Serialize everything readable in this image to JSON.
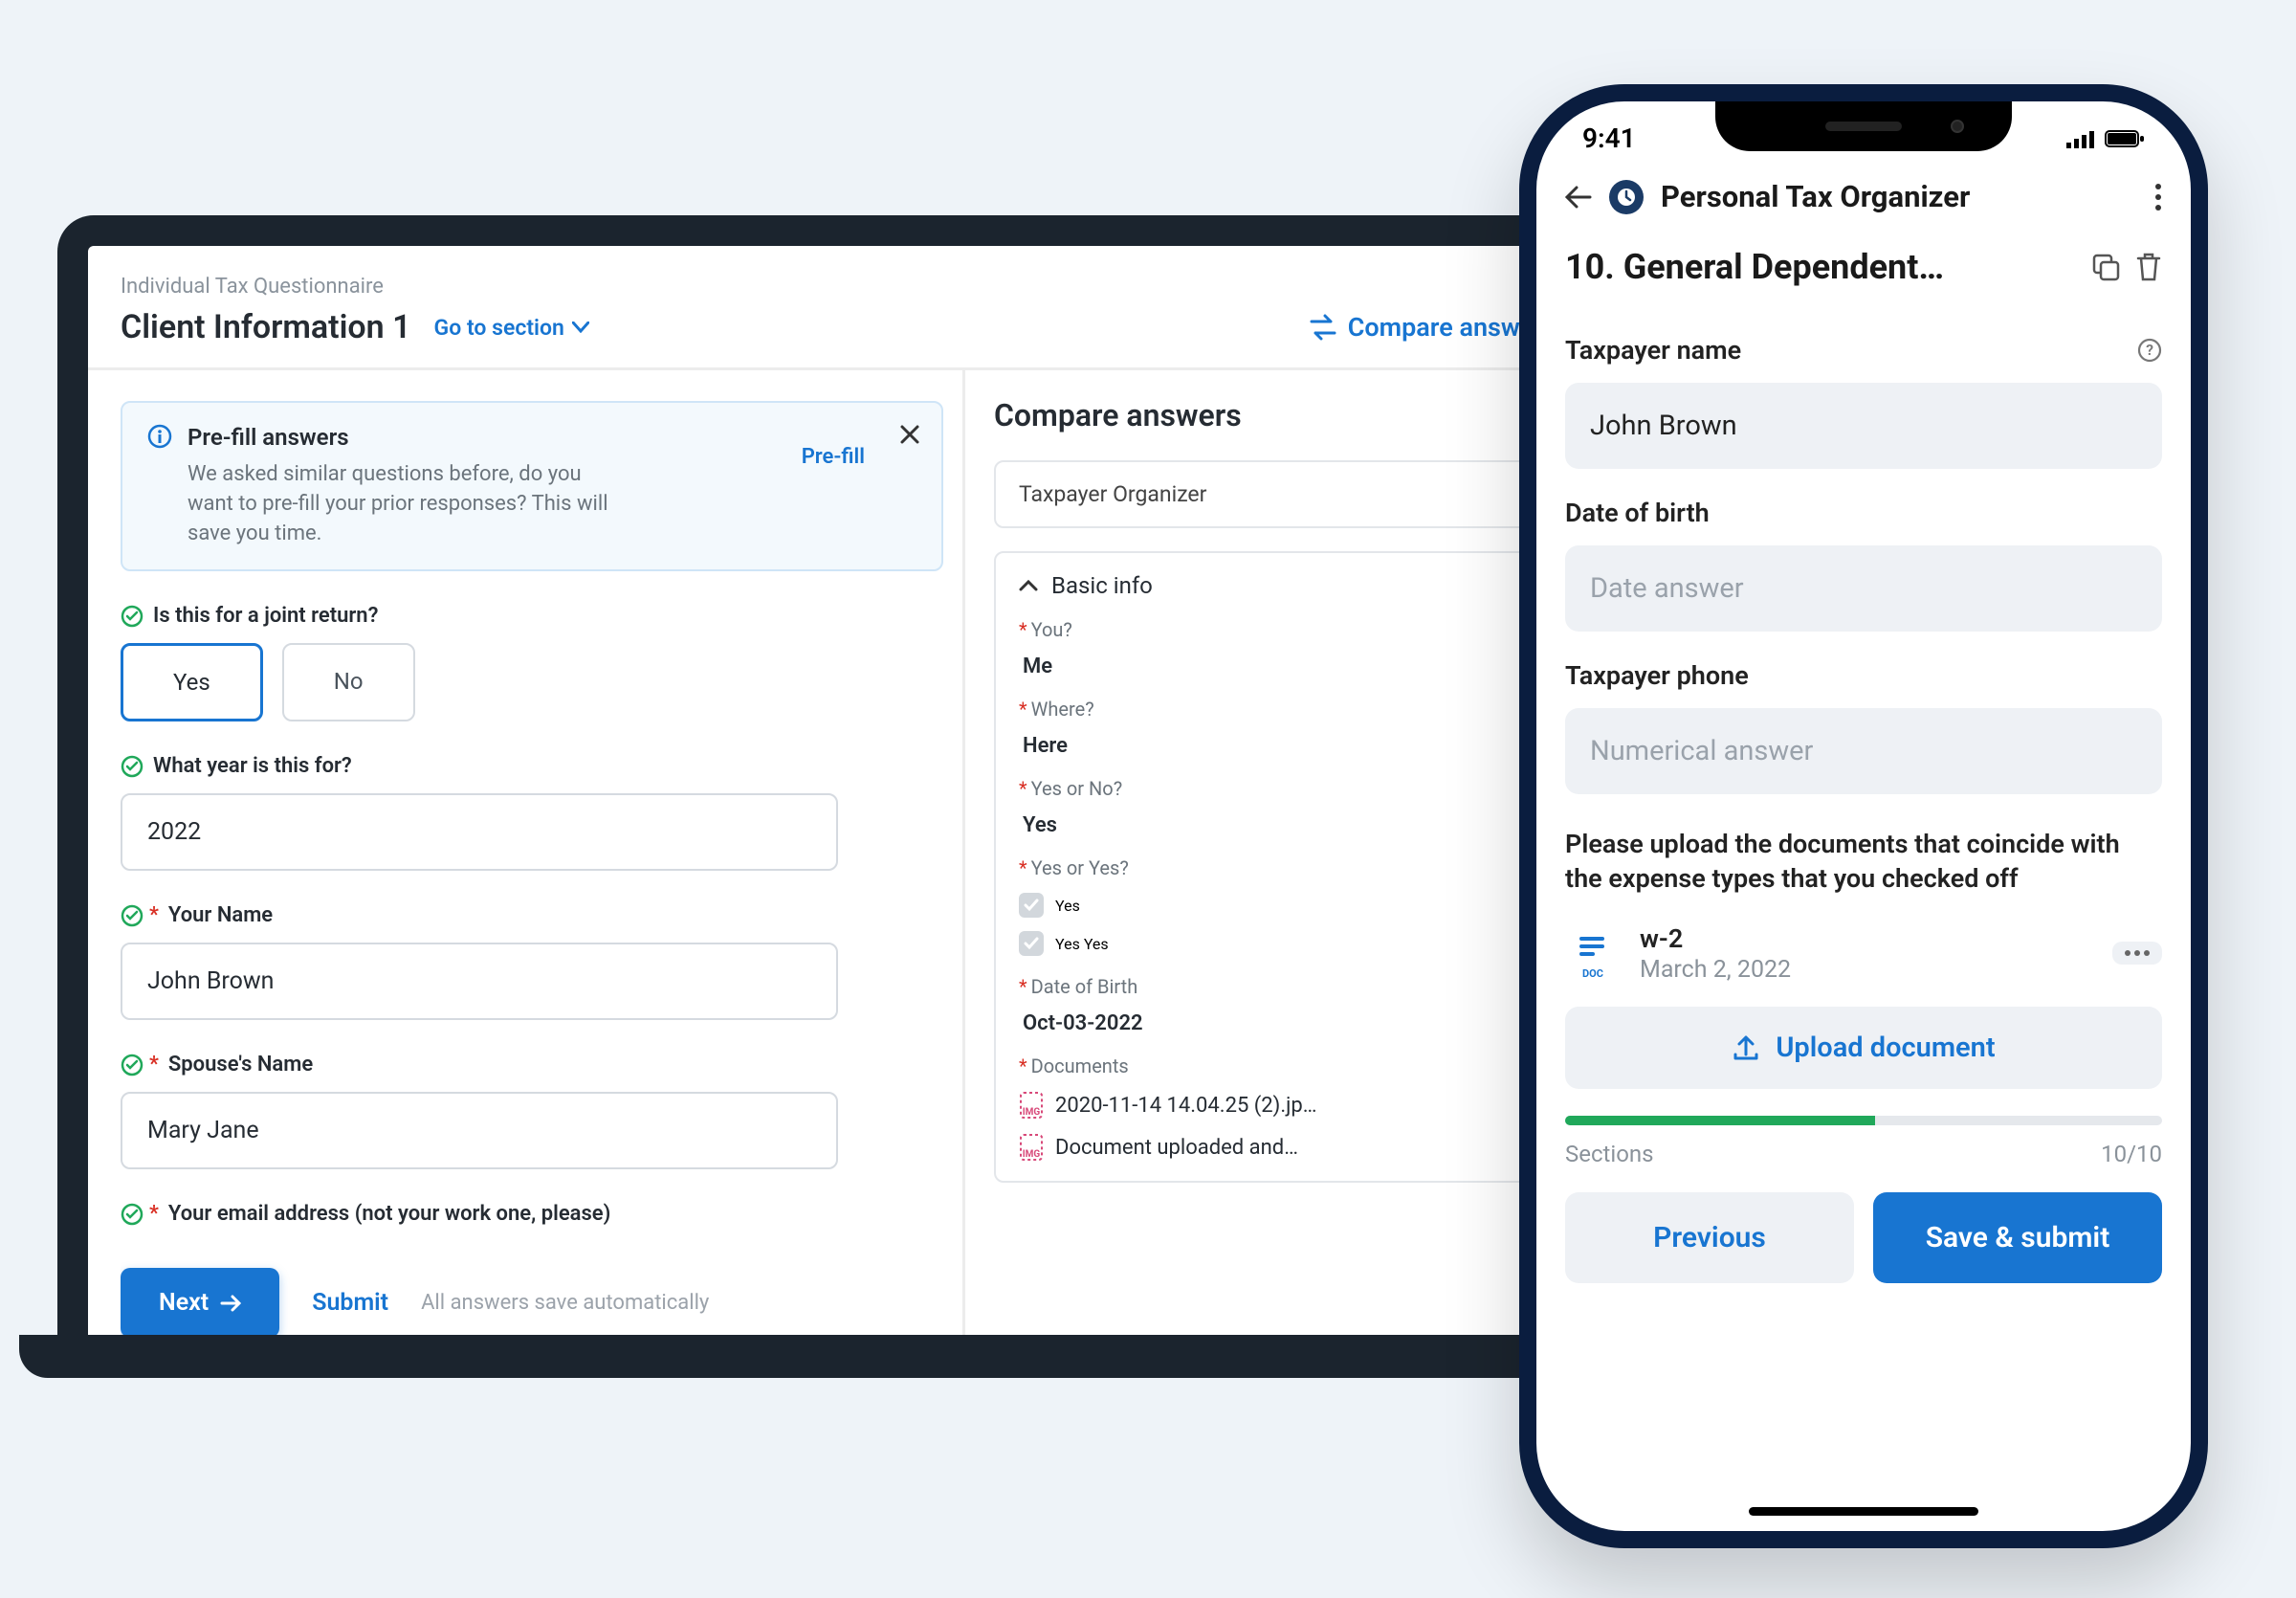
{
  "laptop": {
    "breadcrumb": "Individual Tax Questionnaire",
    "title": "Client Information 1",
    "goto": "Go to section",
    "compare": "Compare answers",
    "prefill": {
      "title": "Pre-fill answers",
      "desc": "We asked similar questions before, do you want to pre-fill your prior responses? This will save you time.",
      "link": "Pre-fill"
    },
    "questions": {
      "joint_label": "Is this for a joint return?",
      "joint_yes": "Yes",
      "joint_no": "No",
      "year_label": "What year is this for?",
      "year_value": "2022",
      "name_label": "Your Name",
      "name_value": "John Brown",
      "spouse_label": "Spouse's Name",
      "spouse_value": "Mary Jane",
      "email_label": "Your email address (not your work one, please)"
    },
    "footer": {
      "next": "Next",
      "submit": "Submit",
      "autosave": "All answers save automatically"
    },
    "sidebar": {
      "title": "Compare answers",
      "organizer": "Taxpayer Organizer",
      "section": "Basic info",
      "you_label": "You?",
      "you_val": "Me",
      "where_label": "Where?",
      "where_val": "Here",
      "yn_label": "Yes or No?",
      "yn_val": "Yes",
      "yy_label": "Yes or Yes?",
      "yy_opt1": "Yes",
      "yy_opt2": "Yes Yes",
      "dob_label": "Date of Birth",
      "dob_val": "Oct-03-2022",
      "docs_label": "Documents",
      "doc1": "2020-11-14 14.04.25 (2).jp…",
      "doc2": "Document uploaded and…"
    }
  },
  "phone": {
    "time": "9:41",
    "app_title": "Personal Tax Organizer",
    "section_title": "10. General Dependent…",
    "taxpayer_name_label": "Taxpayer name",
    "taxpayer_name_value": "John Brown",
    "dob_label": "Date of birth",
    "dob_placeholder": "Date answer",
    "phone_label": "Taxpayer phone",
    "phone_placeholder": "Numerical answer",
    "upload_instr": "Please upload the documents that coincide with the expense types that you checked off",
    "file_name": "w-2",
    "file_date": "March 2, 2022",
    "upload_btn": "Upload document",
    "sections_label": "Sections",
    "sections_count": "10/10",
    "prev": "Previous",
    "save": "Save & submit"
  }
}
